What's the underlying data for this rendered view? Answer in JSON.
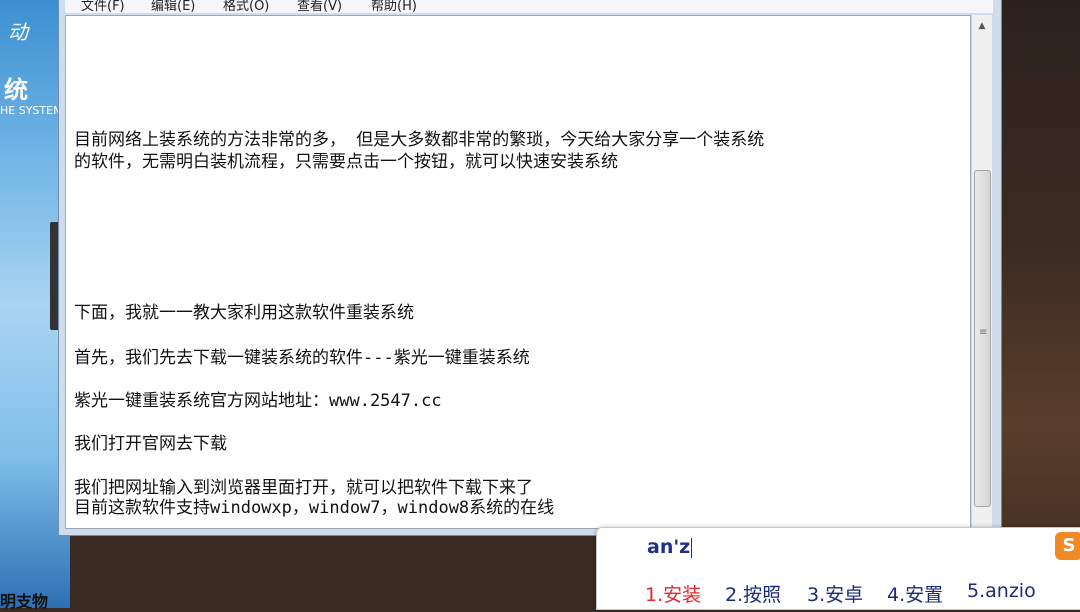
{
  "desktop": {
    "left_logo_text": "动",
    "left_brand": "统",
    "left_subtitle": "HE SYSTEM",
    "left_bottom_text": "明支物"
  },
  "notepad": {
    "menu": [
      "文件(F)",
      "编辑(E)",
      "格式(O)",
      "查看(V)",
      "帮助(H)"
    ],
    "lines": [
      "目前网络上装系统的方法非常的多， 但是大多数都非常的繁琐，今天给大家分享一个装系统",
      "的软件，无需明白装机流程，只需要点击一个按钮，就可以快速安装系统",
      "下面，我就一一教大家利用这款软件重装系统",
      "首先，我们先去下载一键装系统的软件---紫光一键重装系统",
      "紫光一键重装系统官方网站地址：www.2547.cc",
      "我们打开官网去下载",
      "我们把网址输入到浏览器里面打开，就可以把软件下载下来了",
      "目前这款软件支持windowxp，window7，window8系统的在线"
    ]
  },
  "ime": {
    "composition": "an'z",
    "candidates": [
      "1.安装",
      "2.按照",
      "3.安卓",
      "4.安置",
      "5.anzio"
    ],
    "logo": "S",
    "colors": {
      "selected": "#e0282c",
      "normal": "#1b2b7a",
      "logo": "#f08a24"
    }
  }
}
